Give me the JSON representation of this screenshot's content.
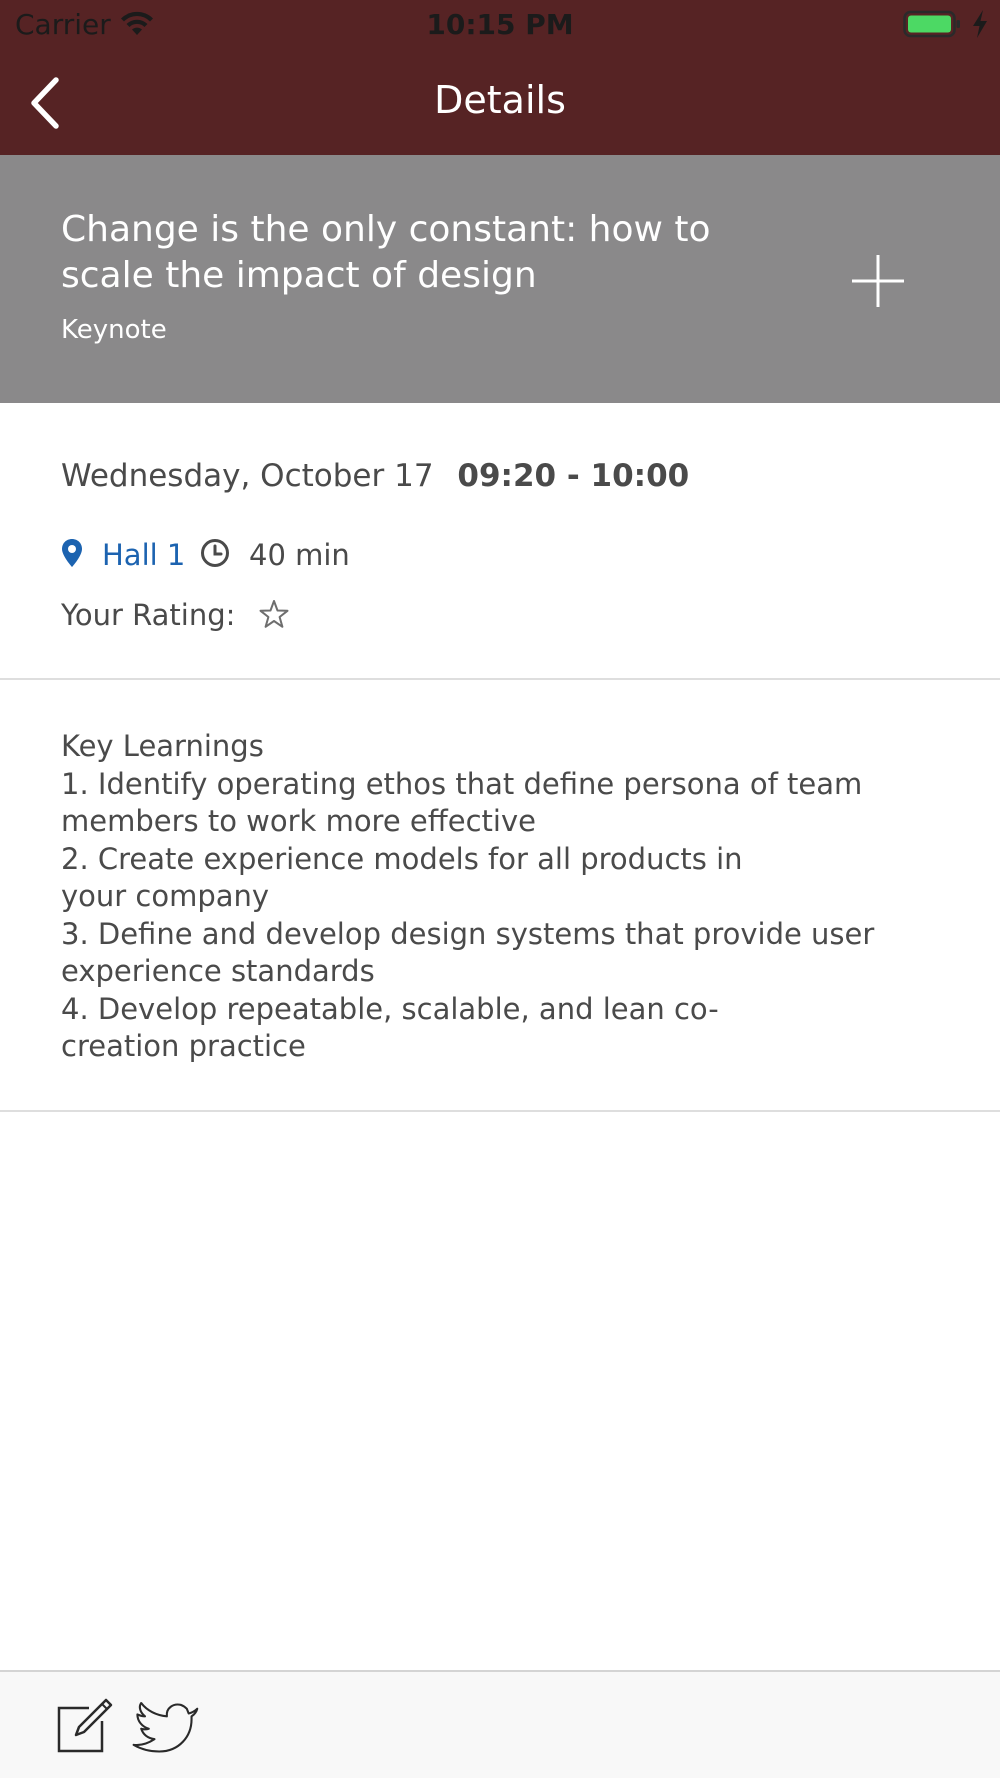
{
  "status_bar": {
    "carrier": "Carrier",
    "time": "10:15 PM",
    "battery_color": "#4cd964"
  },
  "nav": {
    "title": "Details",
    "back_icon": "chevron-left",
    "bar_color": "#562324"
  },
  "session": {
    "title": "Change is the only constant: how to scale the impact of design",
    "type": "Keynote",
    "add_icon": "plus",
    "header_color": "#8a898a"
  },
  "details": {
    "date": "Wednesday, October 17",
    "time_range": "09:20 - 10:00",
    "location": "Hall 1",
    "location_color": "#1c63b0",
    "duration": "40 min",
    "rating_label": "Your Rating:",
    "rating_value": 0,
    "rating_max": 1
  },
  "description": {
    "text": "Key Learnings\n1. Identify operating ethos that define persona of team members to work more effective\n2. Create experience models for all products in\nyour company\n3. Define and develop design systems that provide user experience standards\n4. Develop repeatable, scalable, and lean co-\ncreation practice"
  },
  "toolbar": {
    "note_icon": "note-edit",
    "share_icon": "twitter-bird"
  }
}
